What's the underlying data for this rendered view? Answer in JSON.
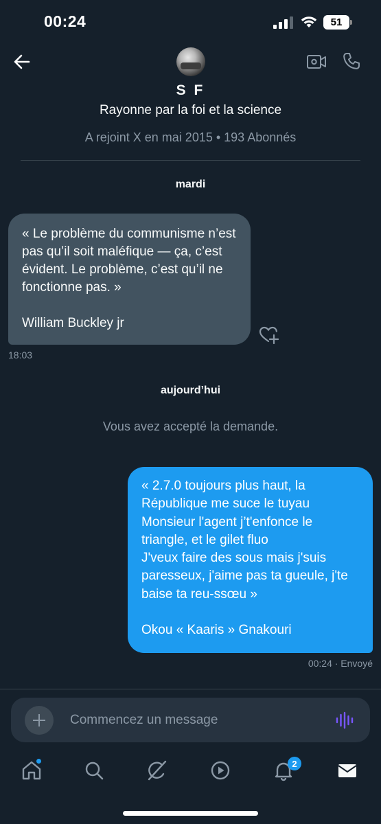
{
  "status_bar": {
    "time": "00:24",
    "battery_level": "51"
  },
  "header": {
    "back_icon": "arrow-left-icon",
    "video_icon": "video-camera-icon",
    "phone_icon": "phone-icon"
  },
  "profile": {
    "name": "S F",
    "bio": "Rayonne par la foi et la science",
    "meta": "A rejoint X en mai 2015 • 193 Abonnés"
  },
  "conversation": {
    "day_1": "mardi",
    "incoming": {
      "text": "« Le problème du communisme n’est pas qu’il soit maléfique — ça, c’est évident. Le problème, c’est qu’il ne fonctionne pas. »\n\nWilliam Buckley jr",
      "time": "18:03",
      "like_icon": "heart-plus-icon"
    },
    "day_2": "aujourd’hui",
    "system_message": "Vous avez accepté la demande.",
    "outgoing": {
      "text": "« 2.7.0 toujours plus haut, la République me suce le tuyau Monsieur l'agent j’t'enfonce le triangle, et le gilet fluo\nJ'veux faire des sous mais j'suis paresseux, j'aime pas ta gueule, j'te baise ta reu-ssœu »\n\nOkou « Kaaris » Gnakouri",
      "status": "00:24 · Envoyé"
    }
  },
  "composer": {
    "placeholder": "Commencez un message",
    "add_icon": "plus-icon",
    "voice_icon": "voice-waveform-icon"
  },
  "tabbar": {
    "notifications_count": "2",
    "icons": [
      "home-icon",
      "search-icon",
      "grok-icon",
      "video-play-icon",
      "bell-icon",
      "envelope-icon"
    ]
  },
  "colors": {
    "background": "#15202b",
    "incoming_bubble": "#425360",
    "outgoing_bubble": "#1d9bf0",
    "secondary_text": "#8b98a5",
    "voice_accent": "#7856ff"
  }
}
